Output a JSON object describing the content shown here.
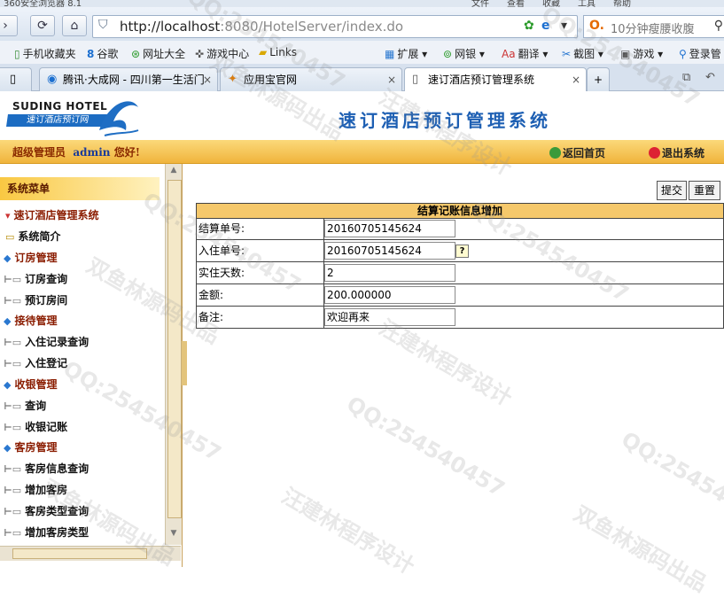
{
  "browser": {
    "url_host": "http://localhost",
    "url_rest": ":8080/HotelServer/index.do",
    "search_placeholder": "10分钟瘦腰收腹",
    "top_strip": [
      "360安全浏览器 8.1",
      "文件",
      "查看",
      "收藏",
      "工具",
      "帮助"
    ],
    "favorites": [
      {
        "icon": "phone-icon",
        "label": "手机收藏夹"
      },
      {
        "icon": "google-icon",
        "label": "谷歌"
      },
      {
        "icon": "globe-icon",
        "label": "网址大全"
      },
      {
        "icon": "gamepad-icon",
        "label": "游戏中心"
      },
      {
        "icon": "folder-icon",
        "label": "Links"
      },
      {
        "icon": "extension-icon",
        "label": "扩展"
      },
      {
        "icon": "bank-icon",
        "label": "网银"
      },
      {
        "icon": "translate-icon",
        "label": "翻译"
      },
      {
        "icon": "screenshot-icon",
        "label": "截图"
      },
      {
        "icon": "game-icon",
        "label": "游戏"
      },
      {
        "icon": "login-icon",
        "label": "登录管"
      }
    ],
    "tabs": [
      {
        "label": "腾讯·大成网 - 四川第一生活门",
        "active": false
      },
      {
        "label": "应用宝官网",
        "active": false
      },
      {
        "label": "速订酒店预订管理系统",
        "active": true
      }
    ]
  },
  "app": {
    "logo_en": "SUDING HOTEL",
    "logo_cn": "速订酒店预订网",
    "title": "速订酒店预订管理系统",
    "user_role": "超级管理员",
    "user_name": "admin",
    "greeting": "您好!",
    "home_link": "返回首页",
    "exit_link": "退出系统"
  },
  "sidebar": {
    "header": "系统菜单",
    "root": "速订酒店管理系统",
    "items": [
      {
        "label": "系统简介",
        "type": "leaf1"
      },
      {
        "label": "订房管理",
        "type": "section"
      },
      {
        "label": "订房查询",
        "type": "leaf"
      },
      {
        "label": "预订房间",
        "type": "leaf"
      },
      {
        "label": "接待管理",
        "type": "section"
      },
      {
        "label": "入住记录查询",
        "type": "leaf"
      },
      {
        "label": "入住登记",
        "type": "leaf"
      },
      {
        "label": "收银管理",
        "type": "section"
      },
      {
        "label": "查询",
        "type": "leaf"
      },
      {
        "label": "收银记账",
        "type": "leaf"
      },
      {
        "label": "客房管理",
        "type": "section"
      },
      {
        "label": "客房信息查询",
        "type": "leaf"
      },
      {
        "label": "增加客房",
        "type": "leaf"
      },
      {
        "label": "客房类型查询",
        "type": "leaf"
      },
      {
        "label": "增加客房类型",
        "type": "leaf"
      }
    ]
  },
  "form": {
    "submit_label": "提交",
    "reset_label": "重置",
    "title": "结算记账信息增加",
    "fields": [
      {
        "label": "结算单号:",
        "value": "20160705145624"
      },
      {
        "label": "入住单号:",
        "value": "20160705145624",
        "help": "?"
      },
      {
        "label": "实住天数:",
        "value": "2"
      },
      {
        "label": "金额:",
        "value": "200.000000"
      },
      {
        "label": "备注:",
        "value": "欢迎再来"
      }
    ]
  },
  "watermarks": [
    "QQ:254540457",
    "汪建林程序设计",
    "双鱼林源码出品"
  ]
}
